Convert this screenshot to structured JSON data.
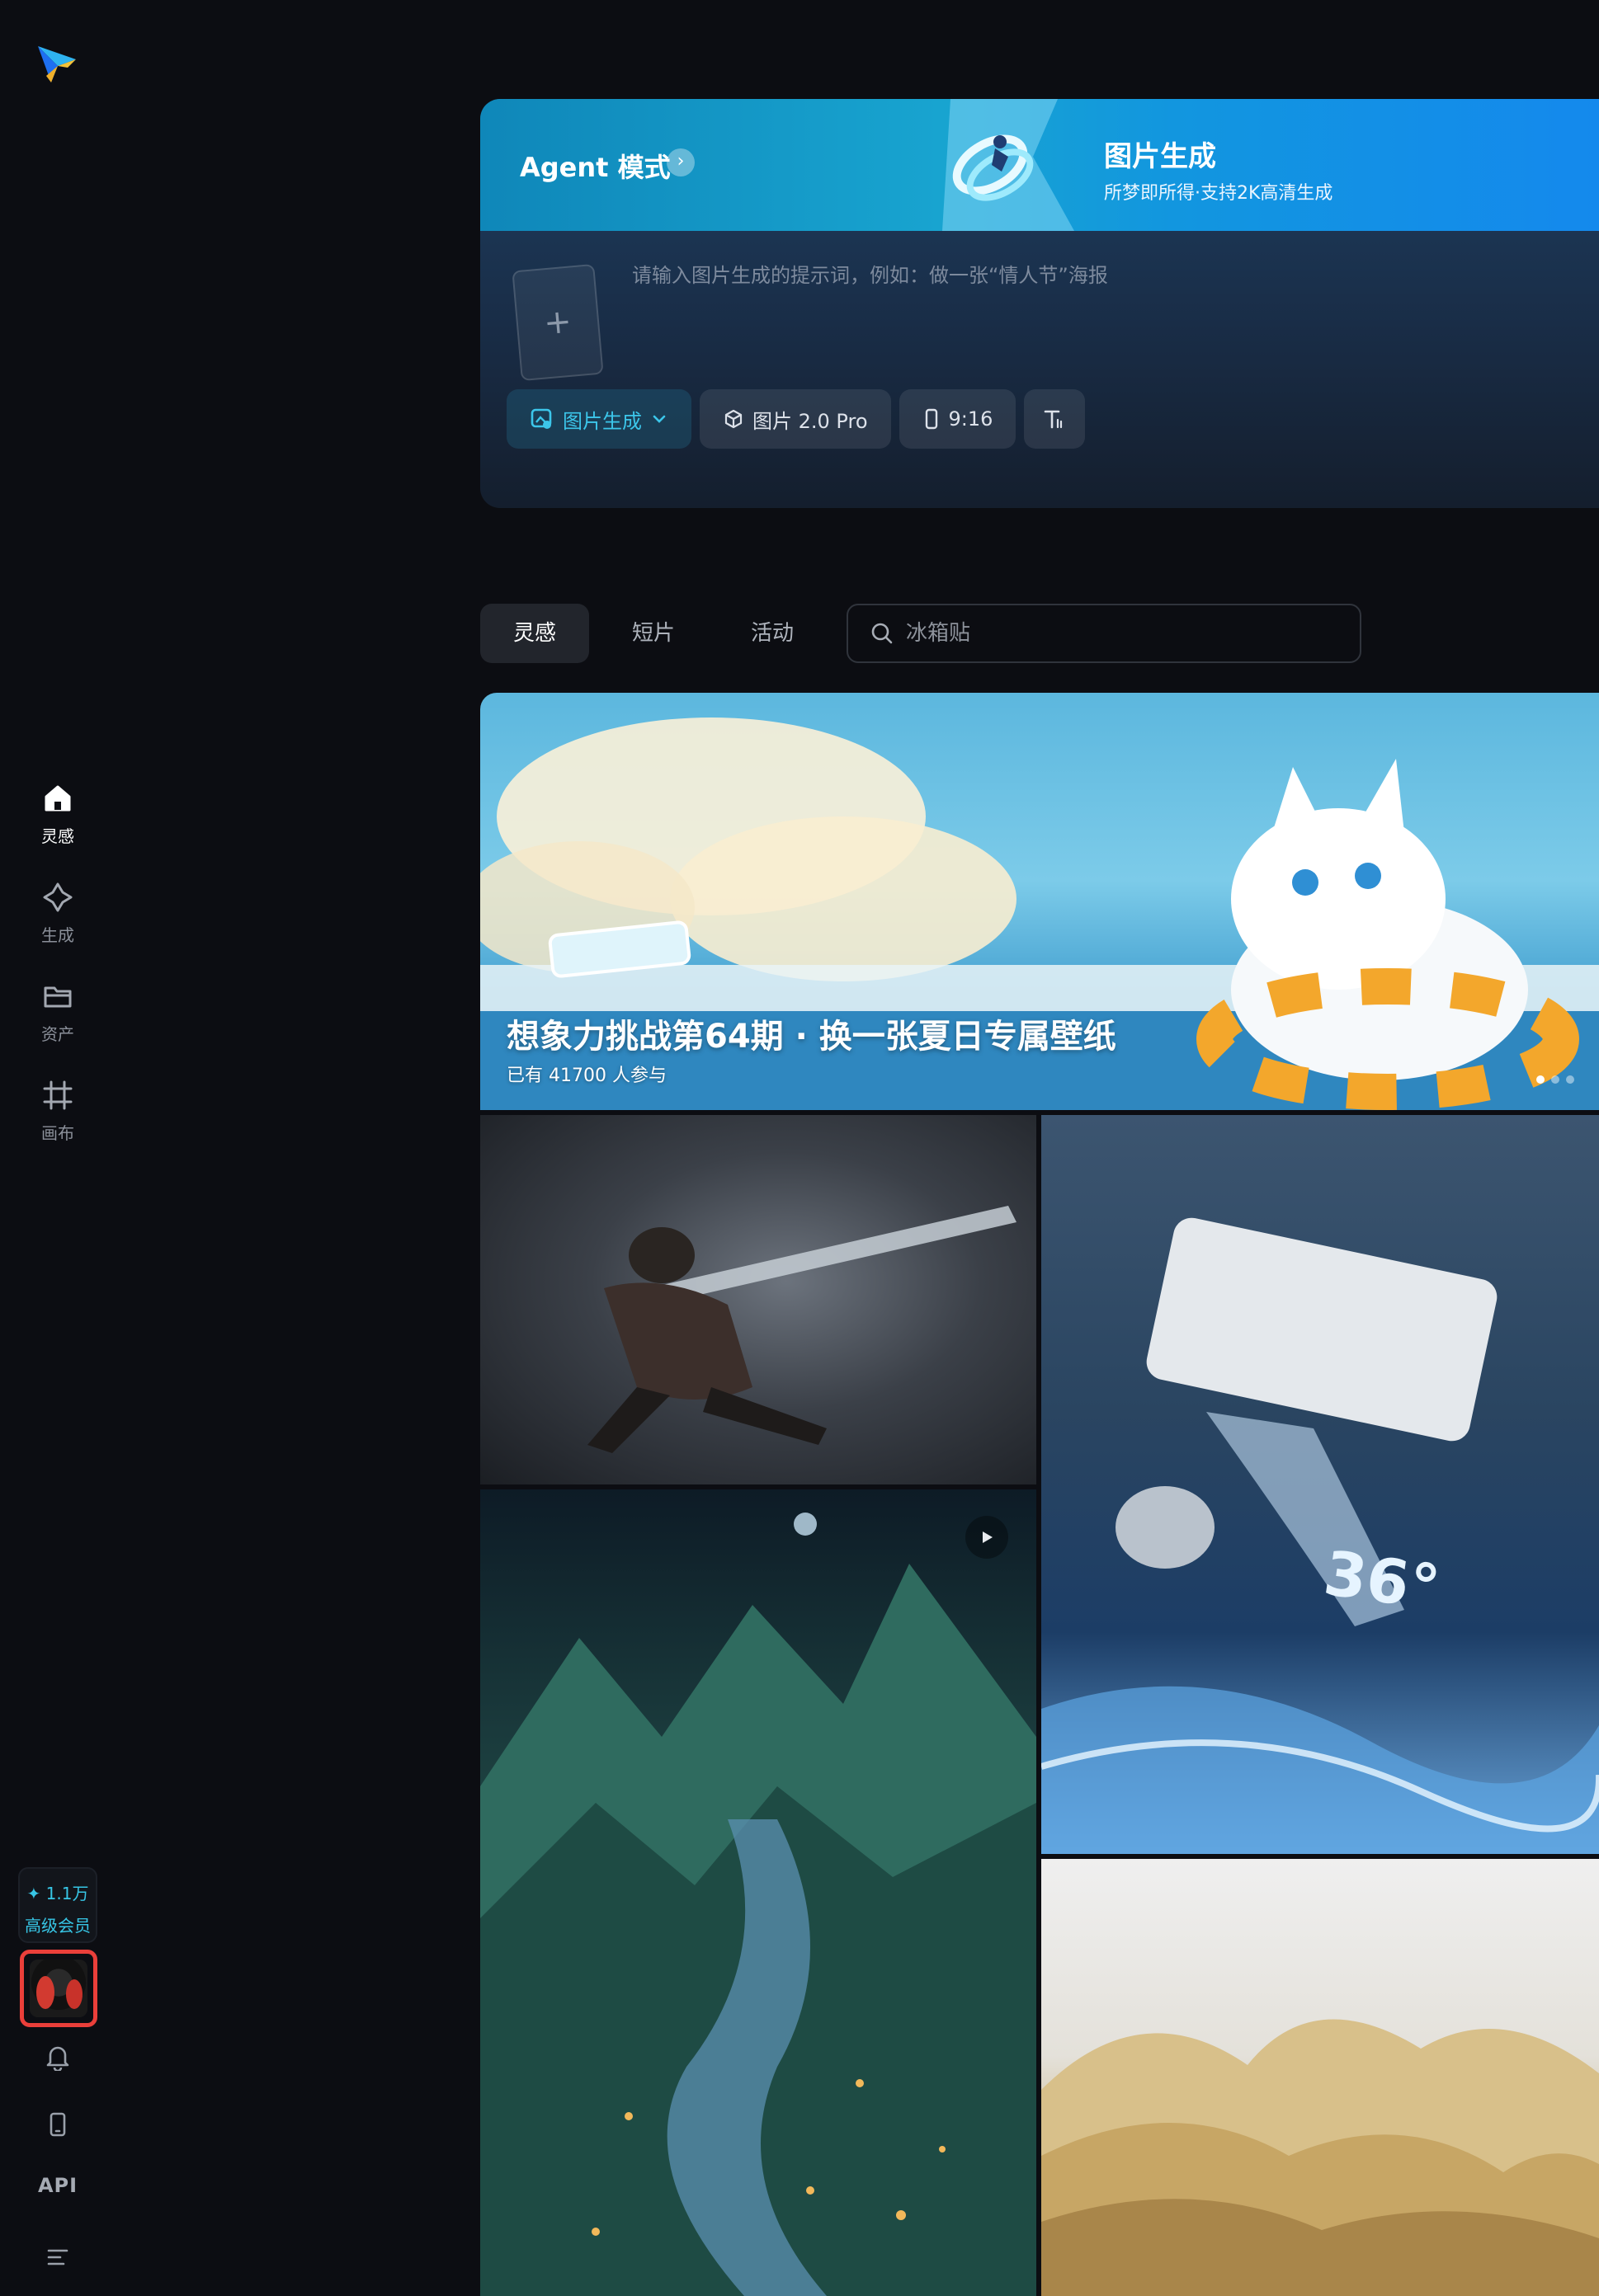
{
  "sidebar": {
    "nav": [
      {
        "label": "灵感",
        "icon": "home-icon",
        "active": true
      },
      {
        "label": "生成",
        "icon": "sparkle-icon",
        "active": false
      },
      {
        "label": "资产",
        "icon": "folder-icon",
        "active": false
      },
      {
        "label": "画布",
        "icon": "canvas-icon",
        "active": false
      }
    ],
    "member": {
      "points": "✦ 1.1万",
      "tier": "高级会员"
    },
    "api_label": "API"
  },
  "composer": {
    "agent_label": "Agent 模式",
    "mode_title": "图片生成",
    "mode_subtitle": "所梦即所得·支持2K高清生成",
    "prompt_placeholder": "请输入图片生成的提示词，例如：做一张“情人节”海报",
    "upload_plus": "+",
    "tools": {
      "mode": "图片生成",
      "model": "图片 2.0 Pro",
      "ratio": "9:16"
    }
  },
  "tabs": [
    {
      "label": "灵感",
      "active": true
    },
    {
      "label": "短片",
      "active": false
    },
    {
      "label": "活动",
      "active": false
    }
  ],
  "search": {
    "placeholder": "冰箱贴"
  },
  "feed": {
    "hero": {
      "title": "想象力挑战第64期 · 换一张夏日专属壁纸",
      "subtitle": "已有 41700 人参与",
      "slides": 3,
      "active_slide": 1
    }
  },
  "colors": {
    "background": "#0c0d12",
    "accent": "#37c6e6",
    "highlight_border": "#ea3f3a"
  }
}
